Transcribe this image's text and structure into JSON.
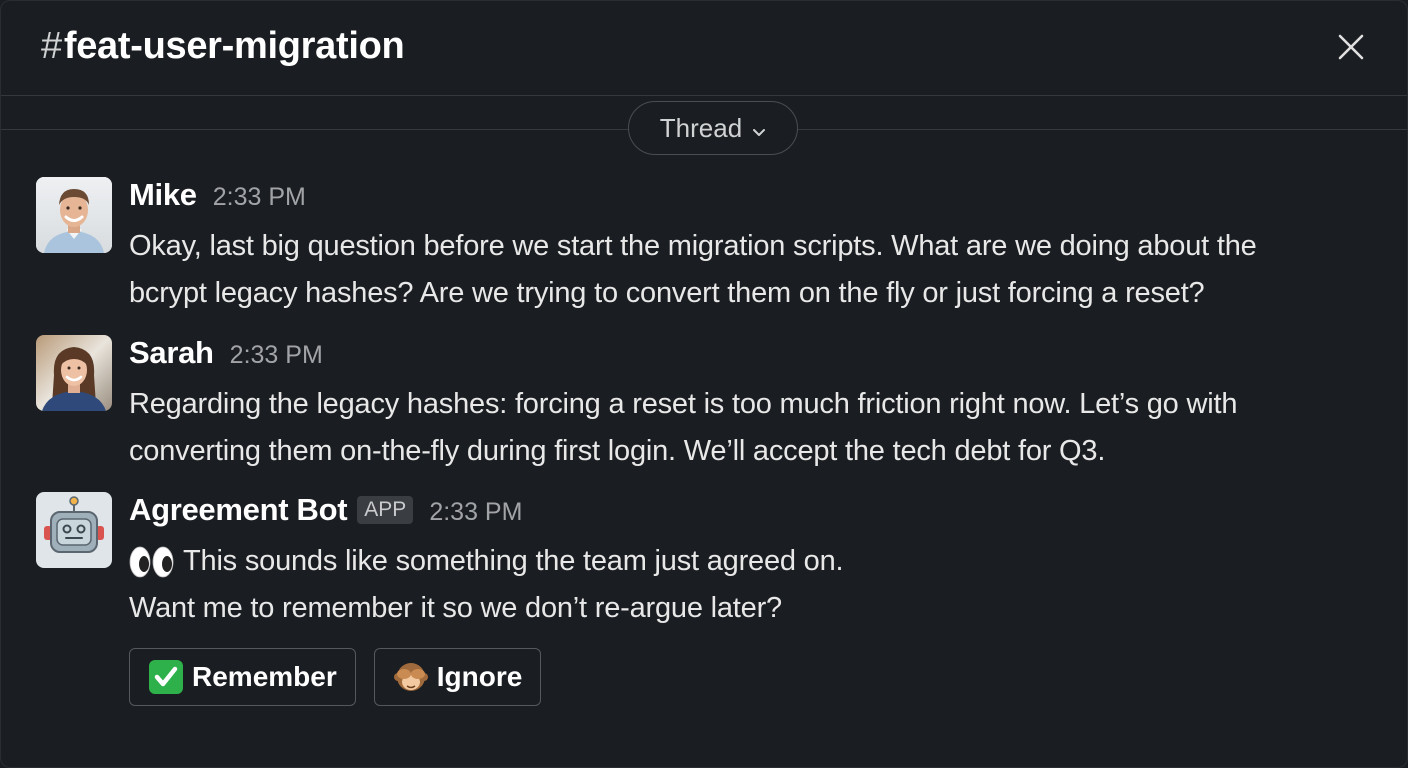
{
  "header": {
    "hash": "#",
    "channel_name": "feat-user-migration"
  },
  "thread_selector": {
    "label": "Thread"
  },
  "messages": [
    {
      "author": "Mike",
      "time": "2:33 PM",
      "lines": [
        "Okay, last big question before we start the migration scripts. What are we doing about the",
        "bcrypt legacy hashes? Are we trying to convert them on the fly or just forcing a reset?"
      ]
    },
    {
      "author": "Sarah",
      "time": "2:33 PM",
      "lines": [
        "Regarding the legacy hashes: forcing a reset is too much friction right now. Let’s go with",
        "converting them on-the-fly during first login. We’ll accept the tech debt for Q3."
      ]
    },
    {
      "author": "Agreement Bot",
      "badge": "APP",
      "time": "2:33 PM",
      "line1": "This sounds like something the team just agreed on.",
      "line2": "Want me to remember it so we don’t re-argue later?",
      "actions": {
        "remember_label": "Remember",
        "ignore_label": "Ignore"
      }
    }
  ],
  "icons": {
    "close": "close-icon",
    "thread_chevron": "chevron-down-icon",
    "eyes": "eyes-emoji",
    "check": "check-mark-emoji",
    "monkey": "see-no-evil-monkey-emoji"
  },
  "colors": {
    "background": "#1a1d21",
    "text": "#e8e8e8",
    "muted": "#a1a3a6",
    "check_green": "#2eb04a"
  }
}
